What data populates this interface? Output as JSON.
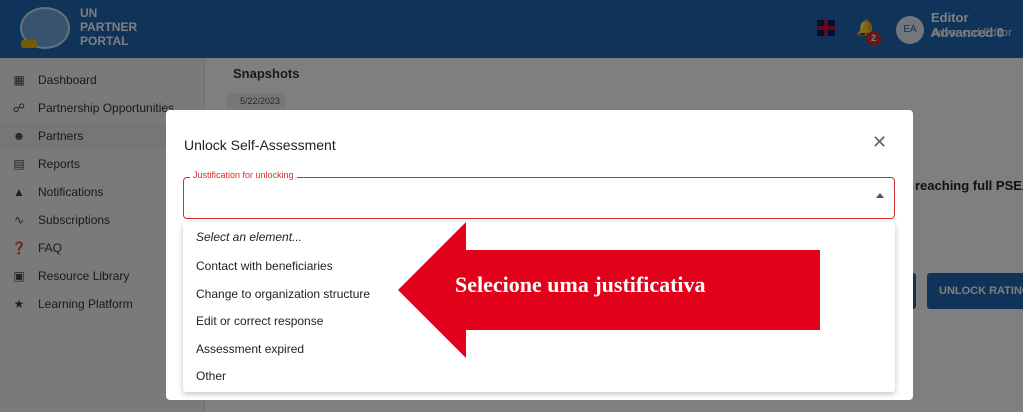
{
  "header": {
    "brand_lines": [
      "UN",
      "PARTNER",
      "PORTAL"
    ],
    "notification_count": "2",
    "avatar_initials": "EA",
    "user_name": "Editor Advanced 0",
    "user_role": "Advanced Editor"
  },
  "sidebar": {
    "items": [
      {
        "label": "Dashboard",
        "icon": "dashboard-icon"
      },
      {
        "label": "Partnership Opportunities",
        "icon": "globe-icon"
      },
      {
        "label": "Partners",
        "icon": "people-icon"
      },
      {
        "label": "Reports",
        "icon": "report-icon"
      },
      {
        "label": "Notifications",
        "icon": "bell-icon"
      },
      {
        "label": "Subscriptions",
        "icon": "rss-icon"
      },
      {
        "label": "FAQ",
        "icon": "help-icon"
      },
      {
        "label": "Resource Library",
        "icon": "book-icon"
      },
      {
        "label": "Learning Platform",
        "icon": "star-icon"
      }
    ],
    "active_index": 2
  },
  "background": {
    "snapshots_title": "Snapshots",
    "snapshot_date": "5/22/2023",
    "psea_text": "reaching full PSEA",
    "unlock_rating_label": "UNLOCK RATING"
  },
  "dialog": {
    "title": "Unlock Self-Assessment",
    "field_label": "Justification for unlocking",
    "options": [
      "Select an element...",
      "Contact with beneficiaries",
      "Change to organization structure",
      "Edit or correct response",
      "Assessment expired",
      "Other"
    ]
  },
  "annotation": {
    "text": "Selecione uma justificativa",
    "color": "#e3001b"
  },
  "colors": {
    "primary": "#1f66b3",
    "error": "#d32f2f"
  }
}
